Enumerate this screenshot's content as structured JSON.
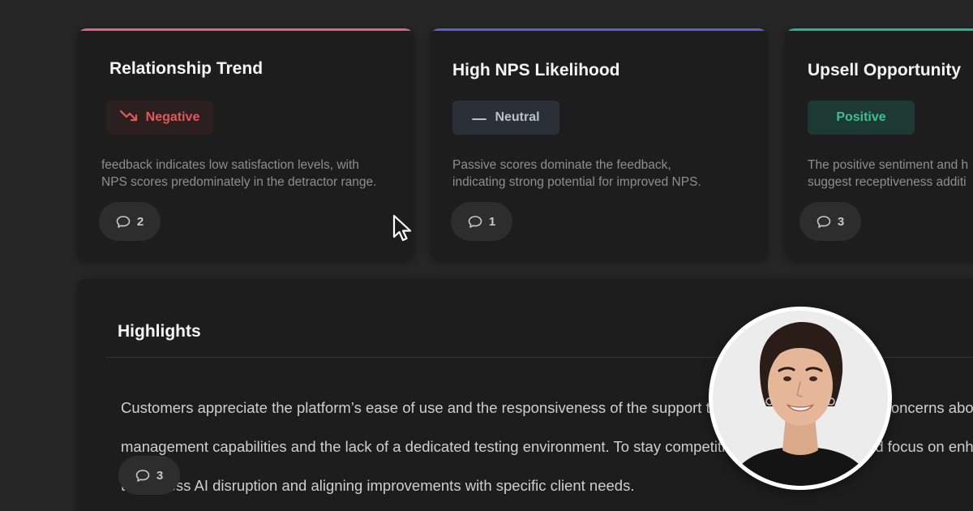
{
  "cards": [
    {
      "title": "Relationship Trend",
      "badge": {
        "label": "Negative",
        "icon": "trend-down-icon",
        "text_color": "#e05a5a",
        "bg_color": "#2b1f1f"
      },
      "description_lines": [
        "feedback indicates low satisfaction levels, with",
        "NPS scores predominately in the detractor range."
      ],
      "comment_count": "2",
      "accent_color": "#e0607a"
    },
    {
      "title": "High NPS Likelihood",
      "badge": {
        "label": "Neutral",
        "icon": "dash-icon",
        "text_color": "#b8c0cc",
        "bg_color": "#2a2f38"
      },
      "description_lines": [
        "Passive scores dominate the feedback,",
        "indicating strong potential for improved NPS."
      ],
      "comment_count": "1",
      "accent_color": "#5a5fcf"
    },
    {
      "title": "Upsell Opportunity",
      "badge": {
        "label": "Positive",
        "icon": "",
        "text_color": "#3fbf8f",
        "bg_color": "#1d3a32"
      },
      "description_lines": [
        "The positive sentiment and h",
        "suggest receptiveness additi"
      ],
      "comment_count": "3",
      "accent_color": "#22b3a5"
    }
  ],
  "highlights": {
    "title": "Highlights",
    "lines": [
      "Customers appreciate the platform’s ease of use and the responsiveness of the support team. However, they raise concerns about c",
      "management capabilities and the lack of a dedicated testing environment. To stay competitive, the company should focus on enhancing t",
      "to address AI disruption and aligning improvements with specific client needs."
    ],
    "comment_count": "3"
  },
  "cursor": {
    "icon": "mouse-pointer-icon"
  },
  "avatar": {
    "icon": "user-avatar"
  }
}
